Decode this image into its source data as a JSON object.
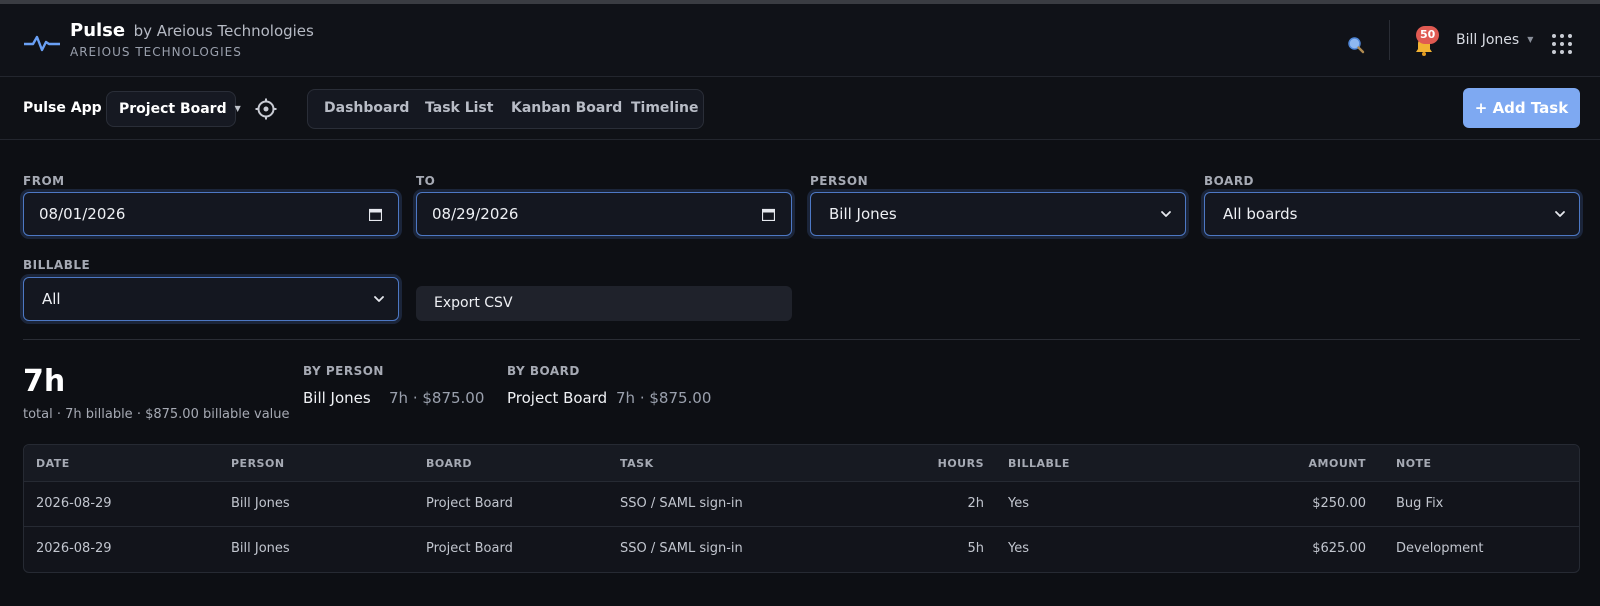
{
  "header": {
    "app_name": "Pulse",
    "by_text": "by Areious Technologies",
    "company": "AREIOUS TECHNOLOGIES",
    "notification_count": "50",
    "user_name": "Bill Jones"
  },
  "toolbar": {
    "app_label": "Pulse App",
    "board_select": "Project Board",
    "tabs": [
      "Dashboard",
      "Task List",
      "Kanban Board",
      "Timeline"
    ],
    "add_task_label": "+ Add Task"
  },
  "filters": {
    "from": {
      "label": "FROM",
      "value": "08/01/2026"
    },
    "to": {
      "label": "TO",
      "value": "08/29/2026"
    },
    "person": {
      "label": "PERSON",
      "value": "Bill Jones"
    },
    "board": {
      "label": "BOARD",
      "value": "All boards"
    },
    "billable": {
      "label": "BILLABLE",
      "value": "All"
    },
    "export_label": "Export CSV"
  },
  "summary": {
    "total": "7h",
    "total_detail": "total · 7h billable · $875.00 billable value",
    "by_person": {
      "title": "BY PERSON",
      "name": "Bill Jones",
      "value": "7h · $875.00"
    },
    "by_board": {
      "title": "BY BOARD",
      "name": "Project Board",
      "value": "7h · $875.00"
    }
  },
  "table": {
    "columns": [
      "DATE",
      "PERSON",
      "BOARD",
      "TASK",
      "HOURS",
      "BILLABLE",
      "AMOUNT",
      "NOTE"
    ],
    "rows": [
      {
        "date": "2026-08-29",
        "person": "Bill Jones",
        "board": "Project Board",
        "task": "SSO / SAML sign-in",
        "hours": "2h",
        "billable": "Yes",
        "amount": "$250.00",
        "note": "Bug Fix"
      },
      {
        "date": "2026-08-29",
        "person": "Bill Jones",
        "board": "Project Board",
        "task": "SSO / SAML sign-in",
        "hours": "5h",
        "billable": "Yes",
        "amount": "$625.00",
        "note": "Development"
      }
    ]
  },
  "colors": {
    "accent": "#7ea9f2",
    "focus_border": "#4d78c4",
    "badge": "#e05a52",
    "background": "#0d0f14"
  },
  "icons": [
    "pulse-logo-icon",
    "search-icon",
    "bell-icon",
    "apps-grid-icon",
    "gear-icon",
    "calendar-icon",
    "chevron-down-icon"
  ]
}
